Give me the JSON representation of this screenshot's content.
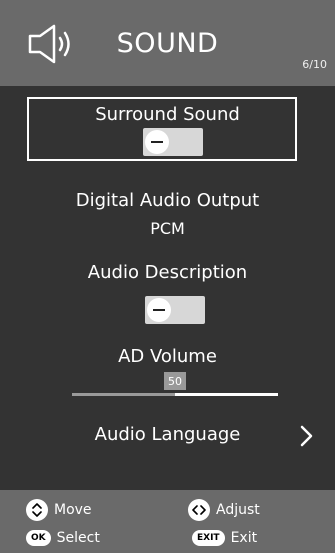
{
  "header": {
    "title": "SOUND",
    "page_indicator": "6/10",
    "icon": "speaker-icon"
  },
  "menu": {
    "items": [
      {
        "label": "Surround Sound",
        "type": "toggle",
        "state": "off",
        "focused": true
      },
      {
        "label": "Digital Audio Output",
        "type": "value",
        "value": "PCM"
      },
      {
        "label": "Audio Description",
        "type": "toggle",
        "state": "off"
      },
      {
        "label": "AD Volume",
        "type": "slider",
        "value": "50",
        "fraction": 0.5
      },
      {
        "label": "Audio Language",
        "type": "submenu",
        "icon": "chevron-right-icon"
      }
    ]
  },
  "footer": {
    "hints": [
      {
        "icon_text": "⌃⌄",
        "label": "Move"
      },
      {
        "icon_text": "<>",
        "label": "Adjust"
      },
      {
        "icon_text": "OK",
        "label": "Select"
      },
      {
        "icon_text": "EXIT",
        "label": "Exit"
      }
    ]
  },
  "colors": {
    "background": "#333333",
    "header_footer": "#6a6a6a",
    "toggle_off": "#d7d7d7"
  }
}
